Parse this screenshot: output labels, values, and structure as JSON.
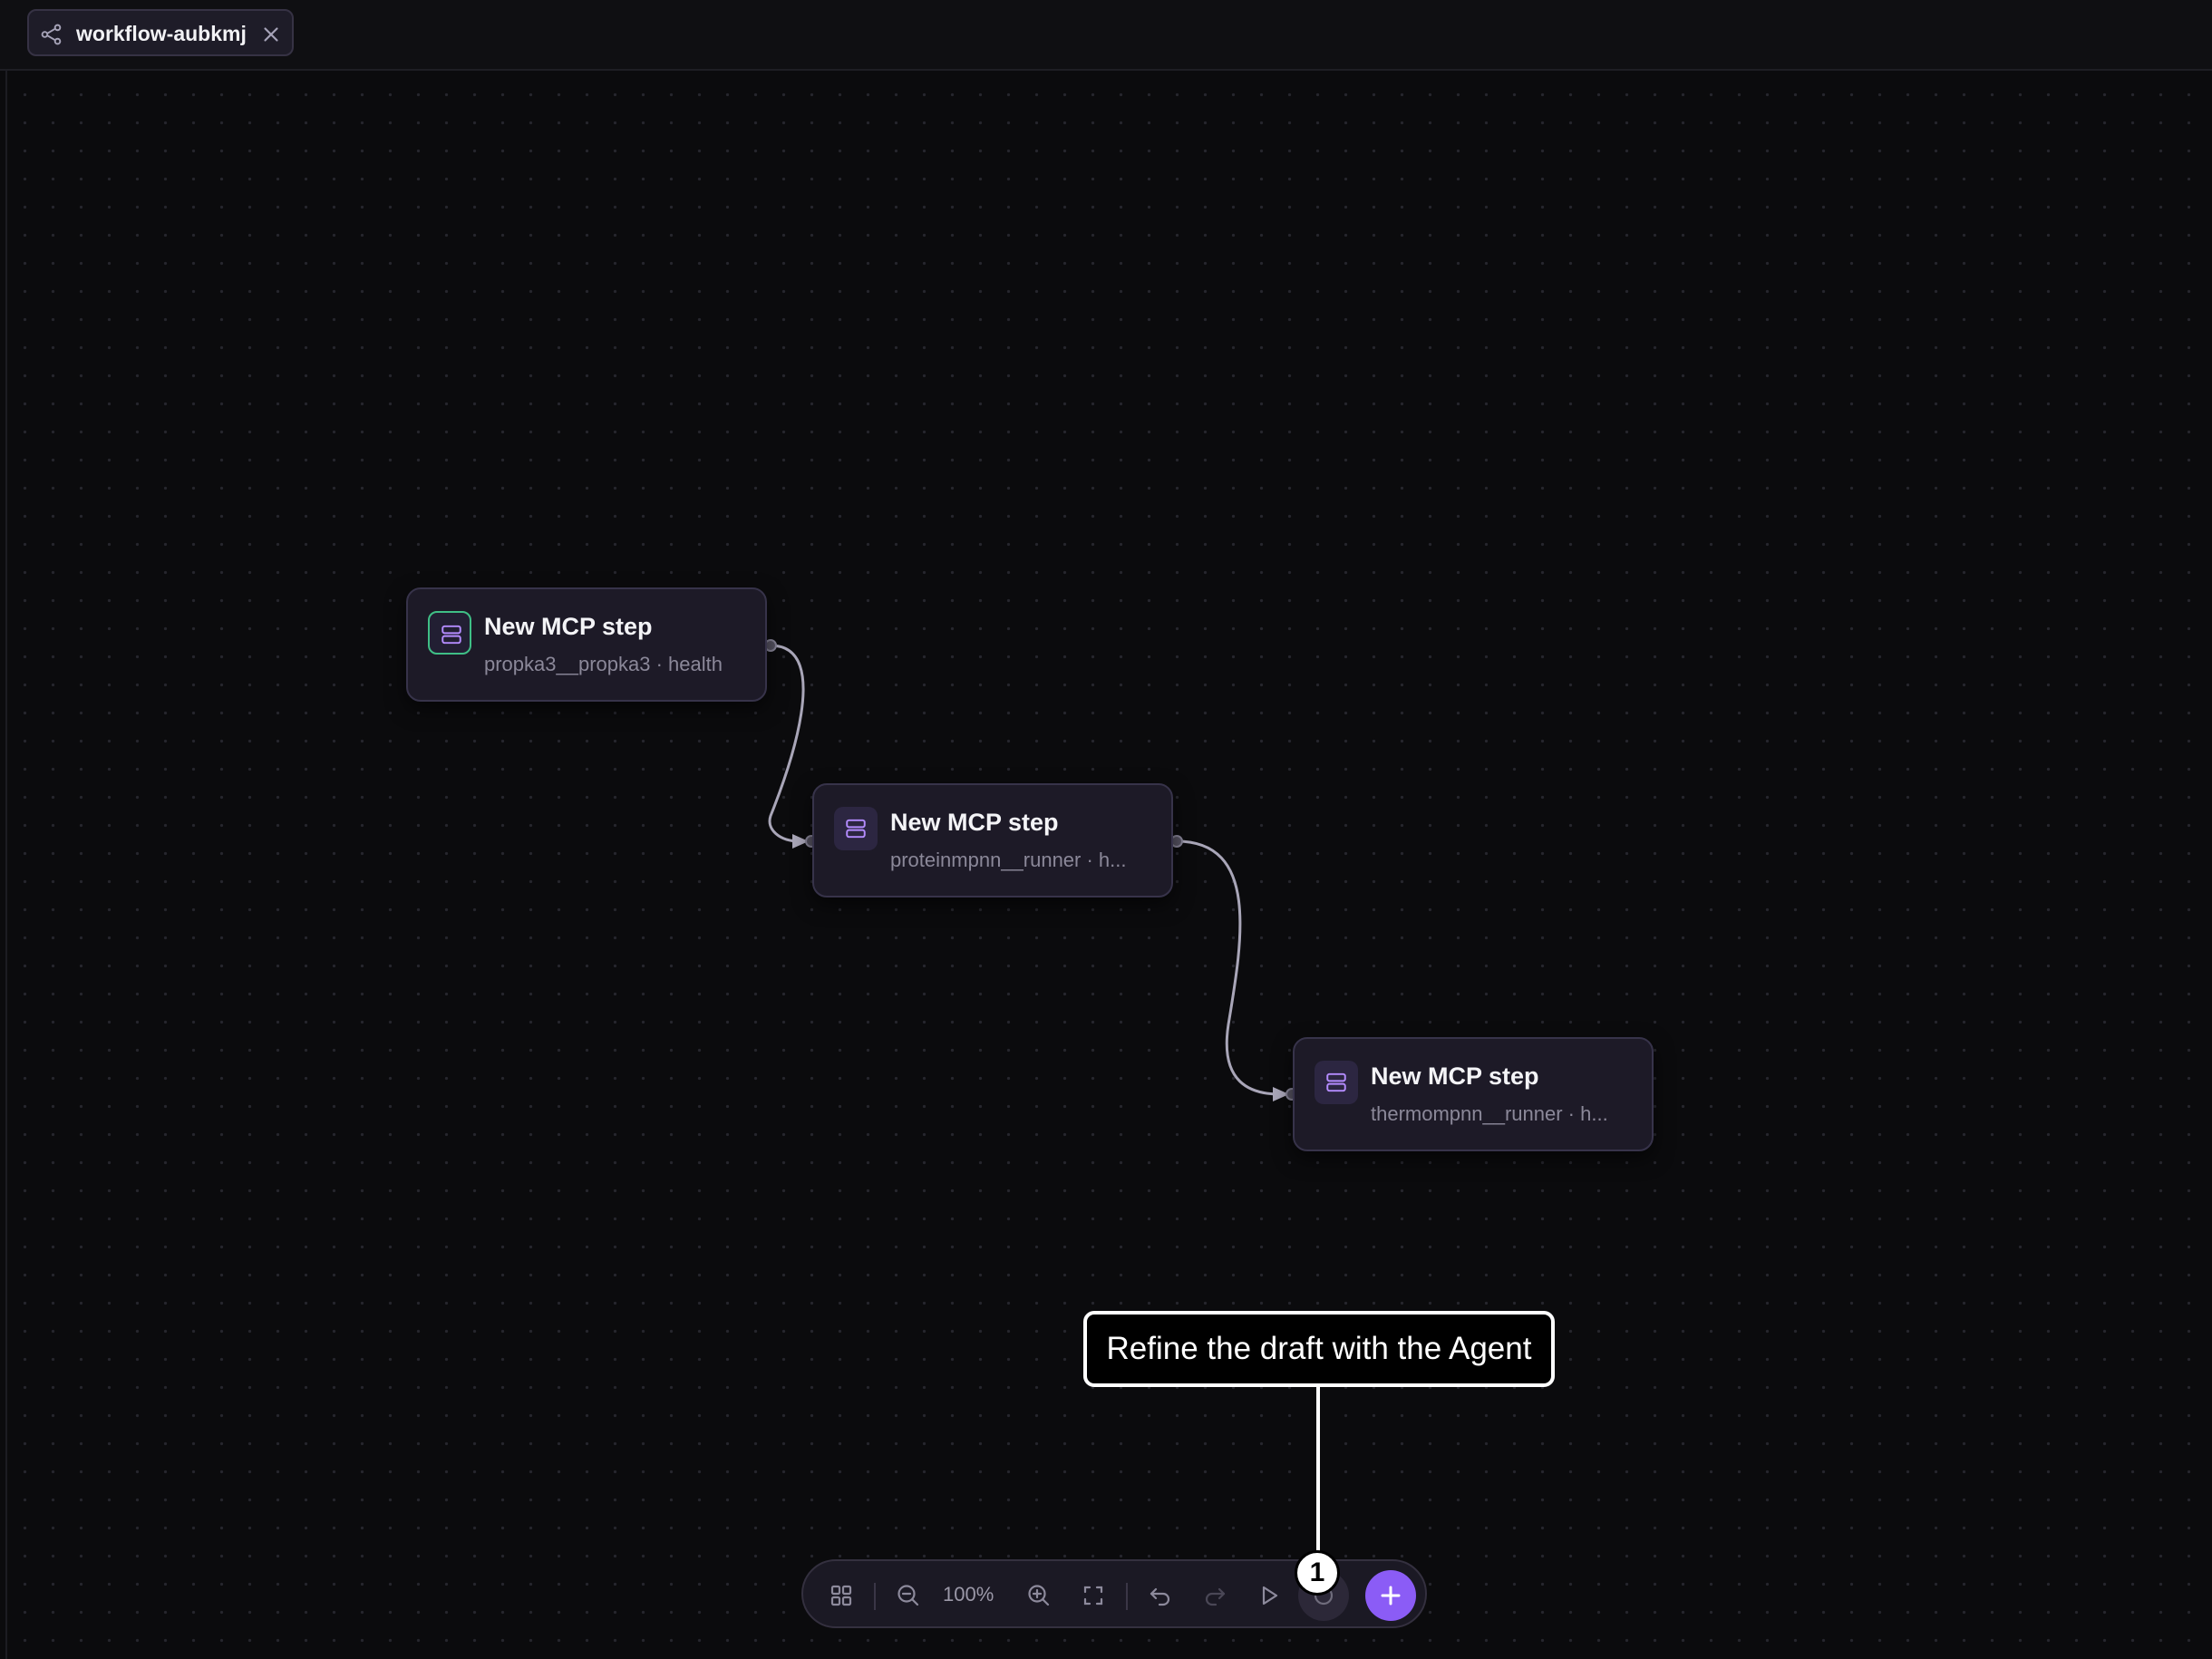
{
  "tab": {
    "title": "workflow-aubkmj",
    "icon": "workflow-icon",
    "close_icon": "close-icon"
  },
  "nodes": [
    {
      "title": "New MCP step",
      "subtitle": "propka3__propka3 · health",
      "icon": "server-icon",
      "selected": true
    },
    {
      "title": "New MCP step",
      "subtitle": "proteinmpnn__runner · h...",
      "icon": "server-icon",
      "selected": false
    },
    {
      "title": "New MCP step",
      "subtitle": "thermompnn__runner · h...",
      "icon": "server-icon",
      "selected": false
    }
  ],
  "toolbar": {
    "zoom": "100%",
    "icons": [
      "layout-grid-icon",
      "zoom-out-icon",
      "zoom-in-icon",
      "fit-view-icon",
      "undo-icon",
      "redo-icon",
      "run-icon",
      "agent-icon",
      "add-icon"
    ]
  },
  "annotation": {
    "text": "Refine the draft with the Agent",
    "badge": "1"
  },
  "colors": {
    "accent": "#8b5cf6",
    "selected_border": "#3fbf86",
    "node_bg": "#1d1a27",
    "canvas_bg": "#0b0b0d"
  }
}
